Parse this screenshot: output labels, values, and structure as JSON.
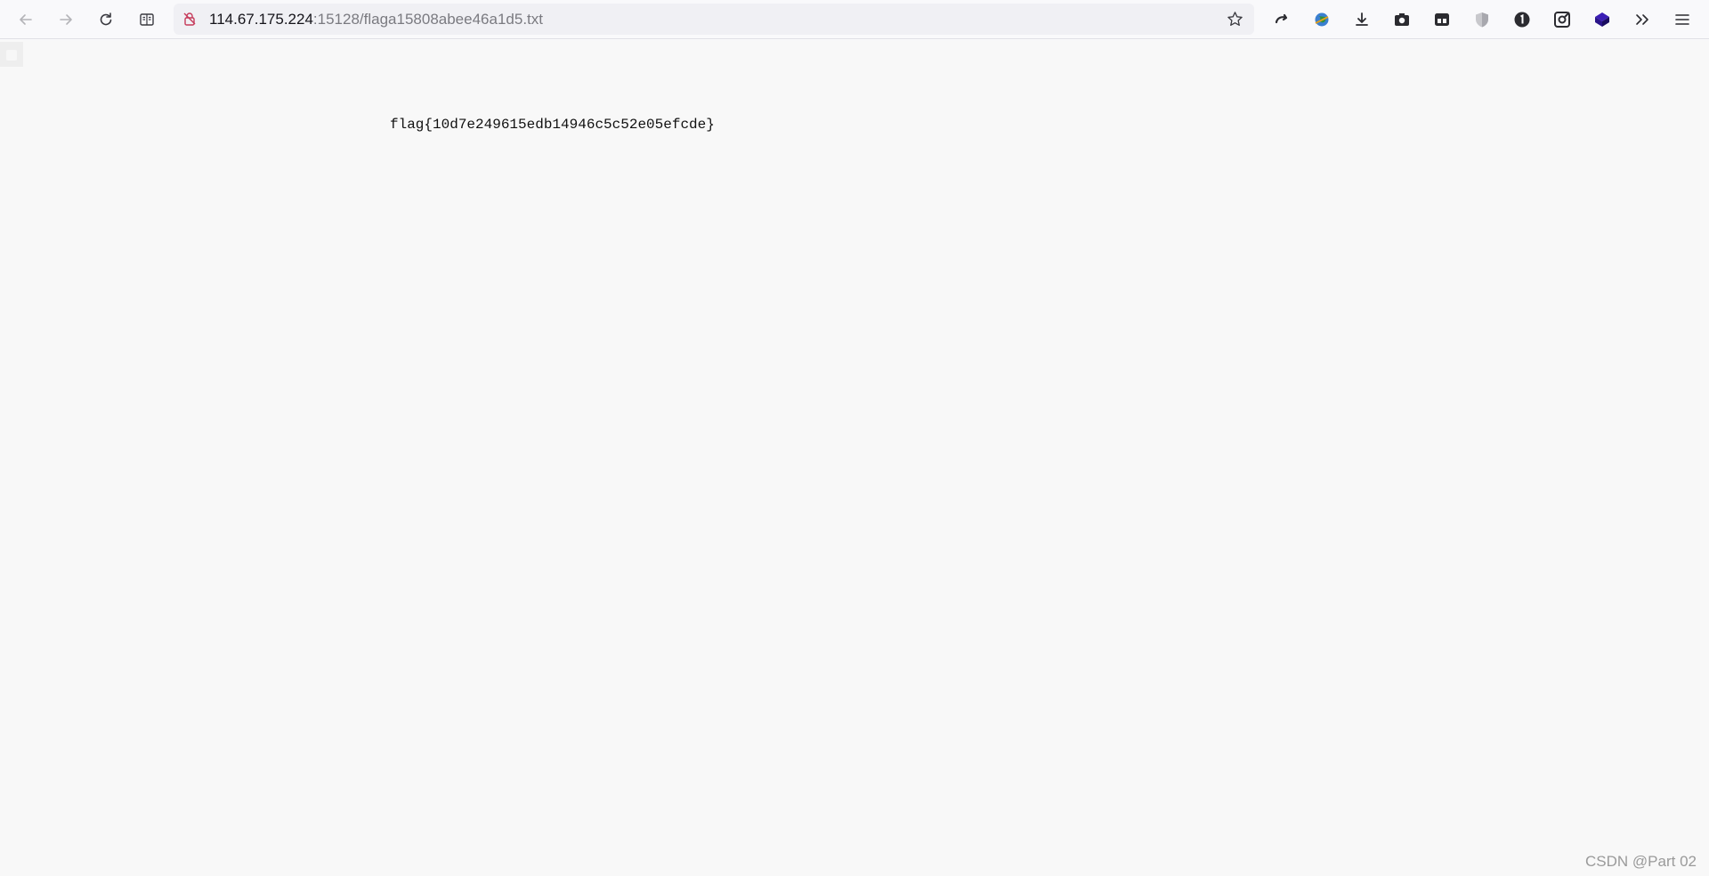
{
  "browser": {
    "url_host": "114.67.175.224",
    "url_rest": ":15128/flaga15808abee46a1d5.txt",
    "nav_icons": [
      "back-arrow-icon",
      "forward-arrow-icon",
      "reload-icon",
      "reader-view-icon"
    ],
    "extension_icons": [
      "undo-arrow-icon",
      "globe-extension-icon",
      "download-icon",
      "screenshot-camera-icon",
      "container-icon",
      "shield-icon",
      "onepassword-icon",
      "link-extension-icon",
      "cube-extension-icon",
      "overflow-chevron-icon",
      "menu-hamburger-icon"
    ],
    "accent_colors": {
      "lock": "#c53a5a",
      "cube": "#3b1eb5",
      "globe": "#2f8f3a"
    }
  },
  "content": {
    "text": "flag{10d7e249615edb14946c5c52e05efcde}"
  },
  "watermark": "CSDN @Part 02"
}
